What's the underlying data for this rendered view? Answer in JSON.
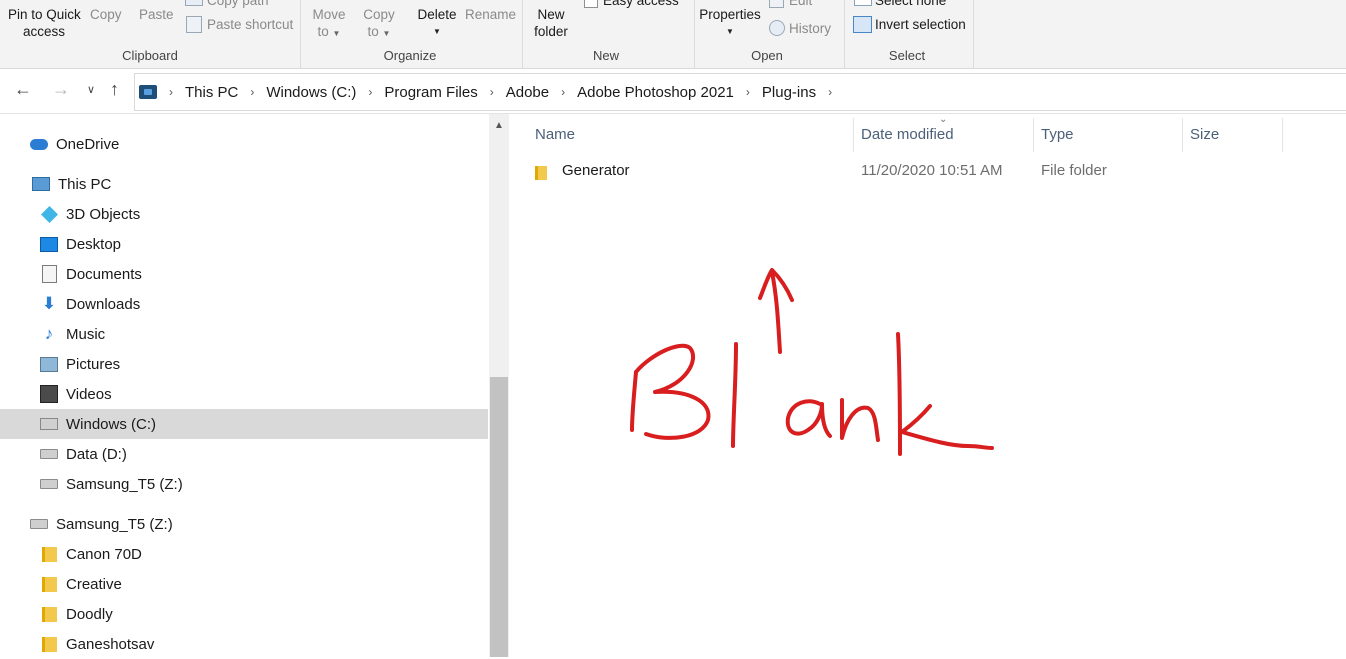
{
  "ribbon": {
    "pin_label": "Pin to Quick\naccess",
    "pin_line1": "Pin to Quick",
    "pin_line2": "access",
    "copy": "Copy",
    "paste": "Paste",
    "copy_path": "Copy path",
    "paste_shortcut": "Paste shortcut",
    "move_to_1": "Move",
    "move_to_2": "to",
    "copy_to_1": "Copy",
    "copy_to_2": "to",
    "delete": "Delete",
    "rename": "Rename",
    "new_folder_1": "New",
    "new_folder_2": "folder",
    "easy_access": "Easy access",
    "properties": "Properties",
    "edit": "Edit",
    "history": "History",
    "select_none": "Select none",
    "invert_selection": "Invert selection",
    "groups": {
      "clipboard": "Clipboard",
      "organize": "Organize",
      "new": "New",
      "open": "Open",
      "select": "Select"
    }
  },
  "address": {
    "crumbs": [
      "This PC",
      "Windows (C:)",
      "Program Files",
      "Adobe",
      "Adobe Photoshop 2021",
      "Plug-ins"
    ]
  },
  "nav": {
    "items": [
      {
        "label": "OneDrive",
        "icon": "cloud-icon"
      },
      {
        "label": "This PC",
        "icon": "computer-icon"
      },
      {
        "label": "3D Objects",
        "icon": "3d-objects-icon"
      },
      {
        "label": "Desktop",
        "icon": "desktop-icon"
      },
      {
        "label": "Documents",
        "icon": "documents-icon"
      },
      {
        "label": "Downloads",
        "icon": "download-arrow-icon"
      },
      {
        "label": "Music",
        "icon": "music-note-icon"
      },
      {
        "label": "Pictures",
        "icon": "pictures-icon"
      },
      {
        "label": "Videos",
        "icon": "videos-icon"
      },
      {
        "label": "Windows (C:)",
        "icon": "windows-drive-icon",
        "selected": true
      },
      {
        "label": "Data (D:)",
        "icon": "drive-icon"
      },
      {
        "label": "Samsung_T5 (Z:)",
        "icon": "drive-icon"
      },
      {
        "label": "Samsung_T5 (Z:)",
        "icon": "drive-icon"
      },
      {
        "label": "Canon 70D",
        "icon": "folder-icon"
      },
      {
        "label": "Creative",
        "icon": "folder-icon"
      },
      {
        "label": "Doodly",
        "icon": "folder-icon"
      },
      {
        "label": "Ganeshotsav",
        "icon": "folder-icon"
      }
    ]
  },
  "columns": {
    "name": "Name",
    "date": "Date modified",
    "type": "Type",
    "size": "Size"
  },
  "files": [
    {
      "name": "Generator",
      "date": "11/20/2020 10:51 AM",
      "type": "File folder",
      "size": ""
    }
  ],
  "annotation": {
    "text": "Blank",
    "color": "#d81e1e"
  }
}
